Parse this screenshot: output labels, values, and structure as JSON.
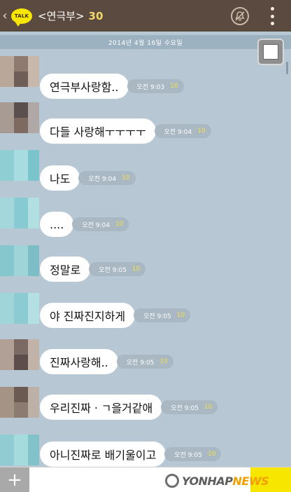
{
  "header": {
    "back_glyph": "‹",
    "talk_badge": "TALK",
    "room_title": "<연극부>",
    "member_count": "30"
  },
  "date_divider": "2014년 4월 16일 수요일",
  "messages": [
    {
      "text": "연극부사랑함..",
      "time": "오전 9:03",
      "unread": "10"
    },
    {
      "text": "다들 사랑해ㅜㅜㅜㅜ",
      "time": "오전 9:04",
      "unread": "10"
    },
    {
      "text": "나도",
      "time": "오전 9:04",
      "unread": "10"
    },
    {
      "text": "....",
      "time": "오전 9:04",
      "unread": "10"
    },
    {
      "text": "정말로",
      "time": "오전 9:05",
      "unread": "10"
    },
    {
      "text": "야 진짜진지하게",
      "time": "오전 9:05",
      "unread": "10"
    },
    {
      "text": "진짜사랑해..",
      "time": "오전 9:05",
      "unread": "10"
    },
    {
      "text": "우리진짜ㆍㄱ을거같애",
      "time": "오전 9:05",
      "unread": "10"
    },
    {
      "text": "아니진짜로 배기울이고",
      "time": "오전 9:05",
      "unread": "10"
    }
  ],
  "input": {
    "plus_glyph": "+",
    "placeholder": ""
  },
  "watermark": {
    "text_main": "YONHAP",
    "text_accent": "NEWS"
  },
  "icons": {
    "back": "chevron-left-icon",
    "mute": "bell-off-icon",
    "menu": "more-vertical-icon",
    "plus": "plus-icon"
  }
}
